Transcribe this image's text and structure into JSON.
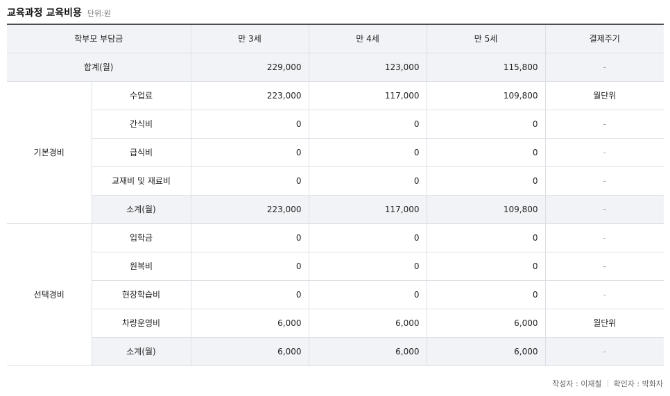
{
  "heading": {
    "title": "교육과정 교육비용",
    "unit": "단위:원"
  },
  "table": {
    "headers": {
      "payer": "학부모 부담금",
      "age3": "만 3세",
      "age4": "만 4세",
      "age5": "만 5세",
      "cycle": "결제주기"
    },
    "total": {
      "label": "합계(월)",
      "age3": "229,000",
      "age4": "123,000",
      "age5": "115,800",
      "cycle": "-"
    },
    "basic": {
      "group": "기본경비",
      "rows": [
        {
          "label": "수업료",
          "age3": "223,000",
          "age4": "117,000",
          "age5": "109,800",
          "cycle": "월단위"
        },
        {
          "label": "간식비",
          "age3": "0",
          "age4": "0",
          "age5": "0",
          "cycle": "-"
        },
        {
          "label": "급식비",
          "age3": "0",
          "age4": "0",
          "age5": "0",
          "cycle": "-"
        },
        {
          "label": "교재비 및 재료비",
          "age3": "0",
          "age4": "0",
          "age5": "0",
          "cycle": "-"
        },
        {
          "label": "소계(월)",
          "age3": "223,000",
          "age4": "117,000",
          "age5": "109,800",
          "cycle": "-"
        }
      ]
    },
    "optional": {
      "group": "선택경비",
      "rows": [
        {
          "label": "입학금",
          "age3": "0",
          "age4": "0",
          "age5": "0",
          "cycle": "-"
        },
        {
          "label": "원복비",
          "age3": "0",
          "age4": "0",
          "age5": "0",
          "cycle": "-"
        },
        {
          "label": "현장학습비",
          "age3": "0",
          "age4": "0",
          "age5": "0",
          "cycle": "-"
        },
        {
          "label": "차량운영비",
          "age3": "6,000",
          "age4": "6,000",
          "age5": "6,000",
          "cycle": "월단위"
        },
        {
          "label": "소계(월)",
          "age3": "6,000",
          "age4": "6,000",
          "age5": "6,000",
          "cycle": "-"
        }
      ]
    }
  },
  "footer": {
    "author": "작성자 : 이재철",
    "reviewer": "확인자 : 박화자"
  }
}
